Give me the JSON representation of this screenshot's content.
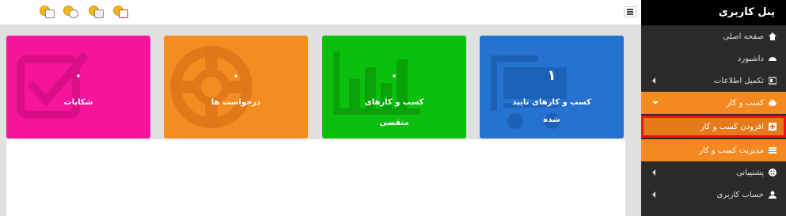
{
  "sidebar": {
    "title": "پنل کاربری",
    "items": [
      {
        "label": "صفحه اصلی",
        "icon": "home-icon"
      },
      {
        "label": "داشبورد",
        "icon": "dashboard-icon"
      },
      {
        "label": "تکمیل اطلاعات",
        "icon": "id-card-icon"
      },
      {
        "label": "کسب و کار",
        "icon": "cloud-icon"
      },
      {
        "label": "افزودن کسب و کار",
        "icon": "plus-square-icon"
      },
      {
        "label": "مدیریت کسب و کار",
        "icon": "list-icon"
      },
      {
        "label": "پشتیبانی",
        "icon": "lifebuoy-icon"
      },
      {
        "label": "حساب کاربری",
        "icon": "user-icon"
      }
    ]
  },
  "tiles": [
    {
      "count": "۱",
      "label_line1": "کسب و کارهای تایید",
      "label_line2": "شده",
      "color": "#2672d0",
      "icon": "cart-icon"
    },
    {
      "count": "۰",
      "label_line1": "کسب و کارهای",
      "label_line2": "منقضی",
      "color": "#0dbf0d",
      "icon": "bar-chart-icon"
    },
    {
      "count": "۰",
      "label_line1": "درخواست ها",
      "label_line2": "",
      "color": "#f58c22",
      "icon": "lifebuoy-icon"
    },
    {
      "count": "۰",
      "label_line1": "شکایات",
      "label_line2": "",
      "color": "#f5149b",
      "icon": "checkbox-icon"
    }
  ],
  "topbar": {
    "icons": [
      "mail-coin-icon",
      "support-coin-icon",
      "balance-coin-icon",
      "calendar-coin-icon"
    ]
  },
  "colors": {
    "sidebar_bg": "#2a2a2a",
    "sidebar_header": "#000000",
    "accent_orange": "#f48a1f",
    "highlight_red": "#e8151b"
  }
}
